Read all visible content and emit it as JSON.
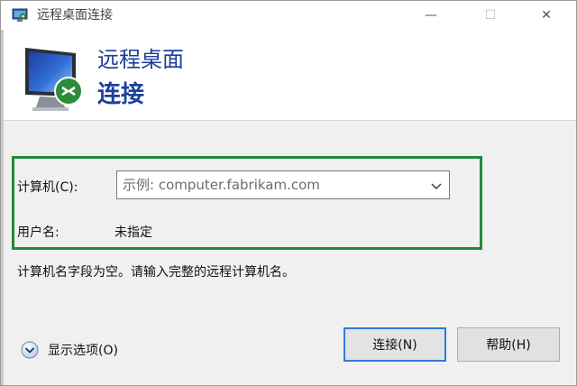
{
  "window": {
    "title": "远程桌面连接",
    "minimize_glyph": "—",
    "maximize_glyph": "☐",
    "close_glyph": "✕"
  },
  "header": {
    "line1": "远程桌面",
    "line2": "连接"
  },
  "form": {
    "computer_label": "计算机(C):",
    "computer_placeholder": "示例: computer.fabrikam.com",
    "username_label": "用户名:",
    "username_value": "未指定",
    "message": "计算机名字段为空。请输入完整的远程计算机名。"
  },
  "footer": {
    "show_options_label": "显示选项(O)",
    "connect_label": "连接(N)",
    "help_label": "帮助(H)"
  },
  "colors": {
    "accent": "#1b3f9a",
    "highlight_border": "#1f8a3a",
    "default_button_border": "#2f7ad6"
  },
  "icons": {
    "app": "remote-desktop-icon",
    "header": "monitor-remote-icon",
    "dropdown": "chevron-down-icon",
    "options": "expand-circle-icon"
  }
}
